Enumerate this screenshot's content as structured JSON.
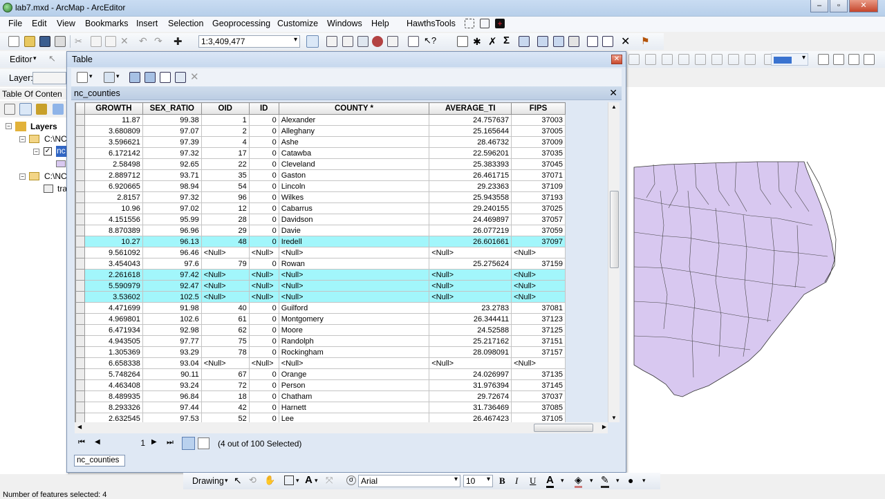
{
  "window": {
    "title": "lab7.mxd - ArcMap - ArcEditor"
  },
  "menu": [
    "File",
    "Edit",
    "View",
    "Bookmarks",
    "Insert",
    "Selection",
    "Geoprocessing",
    "Customize",
    "Windows",
    "Help",
    "HawthsTools"
  ],
  "standard_toolbar": {
    "scale": "1:3,409,477"
  },
  "editor_toolbar": {
    "editor_label": "Editor"
  },
  "layer_toolbar": {
    "layer_label": "Layer:"
  },
  "toc": {
    "header": "Table Of Conten",
    "root": "Layers",
    "items": [
      "C:\\NC",
      "nc",
      "C:\\NC",
      "tra"
    ]
  },
  "table_window": {
    "title": "Table",
    "table_name": "nc_counties",
    "columns": [
      "GROWTH",
      "SEX_RATIO",
      "OID",
      "ID",
      "COUNTY *",
      "AVERAGE_TI",
      "FIPS"
    ],
    "rows": [
      {
        "selected": false,
        "cells": [
          "11.87",
          "99.38",
          "1",
          "0",
          "Alexander",
          "24.757637",
          "37003"
        ]
      },
      {
        "selected": false,
        "cells": [
          "3.680809",
          "97.07",
          "2",
          "0",
          "Alleghany",
          "25.165644",
          "37005"
        ]
      },
      {
        "selected": false,
        "cells": [
          "3.596621",
          "97.39",
          "4",
          "0",
          "Ashe",
          "28.46732",
          "37009"
        ]
      },
      {
        "selected": false,
        "cells": [
          "6.172142",
          "97.32",
          "17",
          "0",
          "Catawba",
          "22.596201",
          "37035"
        ]
      },
      {
        "selected": false,
        "cells": [
          "2.58498",
          "92.65",
          "22",
          "0",
          "Cleveland",
          "25.383393",
          "37045"
        ]
      },
      {
        "selected": false,
        "cells": [
          "2.889712",
          "93.71",
          "35",
          "0",
          "Gaston",
          "26.461715",
          "37071"
        ]
      },
      {
        "selected": false,
        "cells": [
          "6.920665",
          "98.94",
          "54",
          "0",
          "Lincoln",
          "29.23363",
          "37109"
        ]
      },
      {
        "selected": false,
        "cells": [
          "2.8157",
          "97.32",
          "96",
          "0",
          "Wilkes",
          "25.943558",
          "37193"
        ]
      },
      {
        "selected": false,
        "cells": [
          "10.96",
          "97.02",
          "12",
          "0",
          "Cabarrus",
          "29.240155",
          "37025"
        ]
      },
      {
        "selected": false,
        "cells": [
          "4.151556",
          "95.99",
          "28",
          "0",
          "Davidson",
          "24.469897",
          "37057"
        ]
      },
      {
        "selected": false,
        "cells": [
          "8.870389",
          "96.96",
          "29",
          "0",
          "Davie",
          "26.077219",
          "37059"
        ]
      },
      {
        "selected": true,
        "cells": [
          "10.27",
          "96.13",
          "48",
          "0",
          "Iredell",
          "26.601661",
          "37097"
        ]
      },
      {
        "selected": false,
        "cells": [
          "9.561092",
          "96.46",
          "<Null>",
          "<Null>",
          "<Null>",
          "<Null>",
          "<Null>"
        ]
      },
      {
        "selected": false,
        "cells": [
          "3.454043",
          "97.6",
          "79",
          "0",
          "Rowan",
          "25.275624",
          "37159"
        ]
      },
      {
        "selected": true,
        "cells": [
          "2.261618",
          "97.42",
          "<Null>",
          "<Null>",
          "<Null>",
          "<Null>",
          "<Null>"
        ]
      },
      {
        "selected": true,
        "cells": [
          "5.590979",
          "92.47",
          "<Null>",
          "<Null>",
          "<Null>",
          "<Null>",
          "<Null>"
        ]
      },
      {
        "selected": true,
        "cells": [
          "3.53602",
          "102.5",
          "<Null>",
          "<Null>",
          "<Null>",
          "<Null>",
          "<Null>"
        ]
      },
      {
        "selected": false,
        "cells": [
          "4.471699",
          "91.98",
          "40",
          "0",
          "Guilford",
          "23.2783",
          "37081"
        ]
      },
      {
        "selected": false,
        "cells": [
          "4.969801",
          "102.6",
          "61",
          "0",
          "Montgomery",
          "26.344411",
          "37123"
        ]
      },
      {
        "selected": false,
        "cells": [
          "6.471934",
          "92.98",
          "62",
          "0",
          "Moore",
          "24.52588",
          "37125"
        ]
      },
      {
        "selected": false,
        "cells": [
          "4.943505",
          "97.77",
          "75",
          "0",
          "Randolph",
          "25.217162",
          "37151"
        ]
      },
      {
        "selected": false,
        "cells": [
          "1.305369",
          "93.29",
          "78",
          "0",
          "Rockingham",
          "28.098091",
          "37157"
        ]
      },
      {
        "selected": false,
        "cells": [
          "6.658338",
          "93.04",
          "<Null>",
          "<Null>",
          "<Null>",
          "<Null>",
          "<Null>"
        ]
      },
      {
        "selected": false,
        "cells": [
          "5.748264",
          "90.11",
          "67",
          "0",
          "Orange",
          "24.026997",
          "37135"
        ]
      },
      {
        "selected": false,
        "cells": [
          "4.463408",
          "93.24",
          "72",
          "0",
          "Person",
          "31.976394",
          "37145"
        ]
      },
      {
        "selected": false,
        "cells": [
          "8.489935",
          "96.84",
          "18",
          "0",
          "Chatham",
          "29.72674",
          "37037"
        ]
      },
      {
        "selected": false,
        "cells": [
          "8.293326",
          "97.44",
          "42",
          "0",
          "Harnett",
          "31.736469",
          "37085"
        ]
      },
      {
        "selected": false,
        "cells": [
          "2.632545",
          "97.53",
          "52",
          "0",
          "Lee",
          "26.467423",
          "37105"
        ]
      }
    ],
    "record_number": "1",
    "selection_status": "(4 out of 100 Selected)",
    "bottom_tab": "nc_counties"
  },
  "drawing_toolbar": {
    "drawing_label": "Drawing",
    "font": "Arial",
    "font_size": "10"
  },
  "status": {
    "text": "Number of features selected: 4"
  },
  "colors": {
    "selected_row": "#a2f6fb",
    "county_fill": "#d8c8f0"
  }
}
